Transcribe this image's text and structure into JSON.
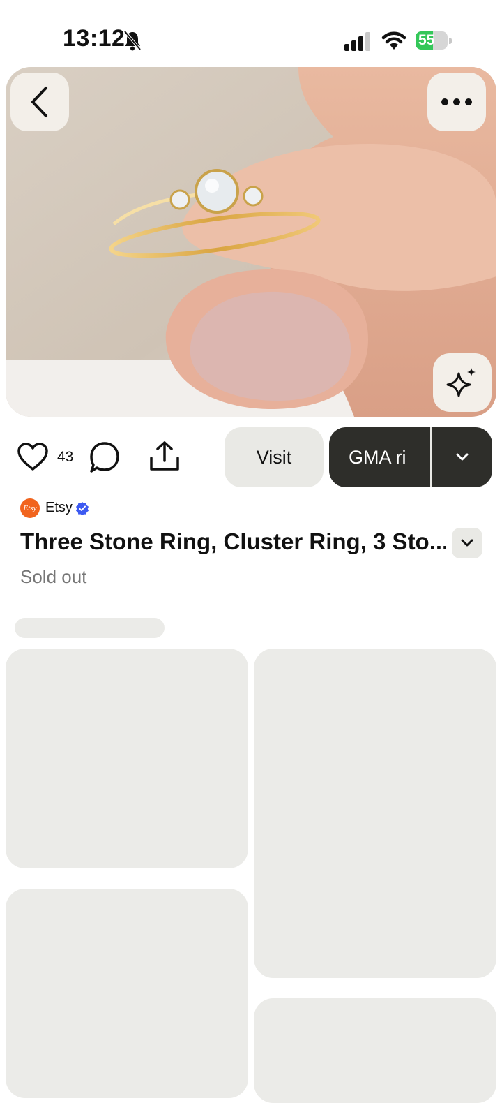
{
  "status_bar": {
    "time": "13:12",
    "battery_level": "55",
    "battery_fraction": 0.55,
    "icons": [
      "bell-slash-icon",
      "cellular-signal-icon",
      "wifi-icon",
      "battery-charging-icon"
    ]
  },
  "hero": {
    "image": "gold three stone ring held between fingers",
    "buttons": [
      "back-icon",
      "more-icon",
      "sparkle-icon"
    ]
  },
  "actions": {
    "like_count": "43",
    "visit_label": "Visit",
    "board_label": "GMA ri",
    "icons": [
      "heart-icon",
      "comment-icon",
      "share-icon",
      "chevron-down-icon"
    ]
  },
  "product": {
    "merchant_logo_text": "Etsy",
    "merchant_name": "Etsy",
    "title": "Three Stone Ring, Cluster Ring, 3 Sto...",
    "status": "Sold out"
  },
  "colors": {
    "accent_dark": "#2e2e2a",
    "button_light": "#e9e9e5",
    "etsy_orange": "#f1641e",
    "verified_blue": "#3d5af1",
    "battery_green": "#34c759"
  }
}
